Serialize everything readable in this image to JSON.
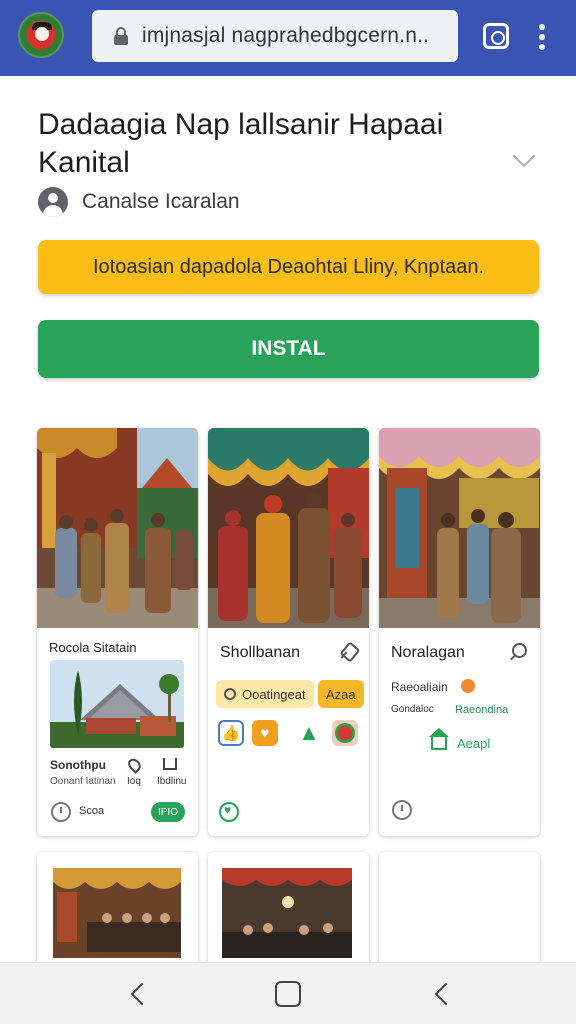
{
  "browser": {
    "url": "imjnasjal nagprahedbgcern.n..",
    "icons": [
      "site-logo",
      "lock-icon",
      "tabs-icon",
      "menu-icon"
    ]
  },
  "app": {
    "title": "Dadaagia Nap lallsanir Hapaai Kanital",
    "developer": "Canalse Icaralan",
    "notice": "Iotoasian dapadola Deaohtai Lliny, Knptaan.",
    "install_label": "INSTAL"
  },
  "cards": [
    {
      "title": "Rocola Sitatain",
      "info_title": "Sonothpu",
      "info_sub": "Oonanf Iatinan",
      "icon_labels": [
        "Ioq",
        "Ibdlinu"
      ],
      "footer_text": "Scoa",
      "badge": "IPIO"
    },
    {
      "title": "Shollbanan",
      "pill_left": "Ooatingeat",
      "pill_right": "Azaa"
    },
    {
      "title": "Noralagan",
      "line1": "Raeoaliain",
      "line2_left": "Gondaloc",
      "line2_right": "Raeondina",
      "action_label": "Aeapl"
    }
  ],
  "colors": {
    "topbar": "#3a54b4",
    "notice": "#fbbd16",
    "install": "#2aa35a"
  }
}
